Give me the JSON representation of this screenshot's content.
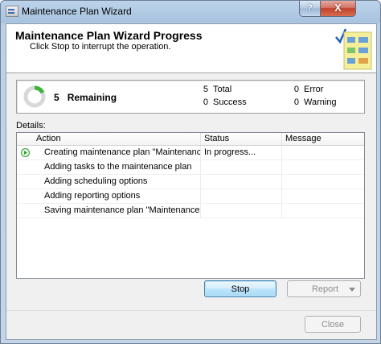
{
  "window": {
    "title": "Maintenance Plan Wizard",
    "help_label": "?",
    "close_label": "X"
  },
  "header": {
    "title": "Maintenance Plan Wizard Progress",
    "subtitle": "Click Stop to interrupt the operation."
  },
  "summary": {
    "remaining_count": "5",
    "remaining_label": "Remaining",
    "total_count": "5",
    "total_label": "Total",
    "success_count": "0",
    "success_label": "Success",
    "error_count": "0",
    "error_label": "Error",
    "warning_count": "0",
    "warning_label": "Warning"
  },
  "details": {
    "label": "Details:",
    "columns": [
      "Action",
      "Status",
      "Message"
    ],
    "rows": [
      {
        "action": "Creating maintenance plan \"Maintenanc...",
        "status": "In progress...",
        "message": "",
        "icon": "running-arrow-icon"
      },
      {
        "action": "Adding tasks to the maintenance plan",
        "status": "",
        "message": ""
      },
      {
        "action": "Adding scheduling options",
        "status": "",
        "message": ""
      },
      {
        "action": "Adding reporting options",
        "status": "",
        "message": ""
      },
      {
        "action": "Saving maintenance plan \"Maintenance...",
        "status": "",
        "message": ""
      }
    ]
  },
  "buttons": {
    "stop": "Stop",
    "report": "Report",
    "close": "Close"
  },
  "colors": {
    "title_bar": "#a9c3df",
    "default_button": "#bee6fd",
    "running_icon": "#2e9d2e"
  }
}
